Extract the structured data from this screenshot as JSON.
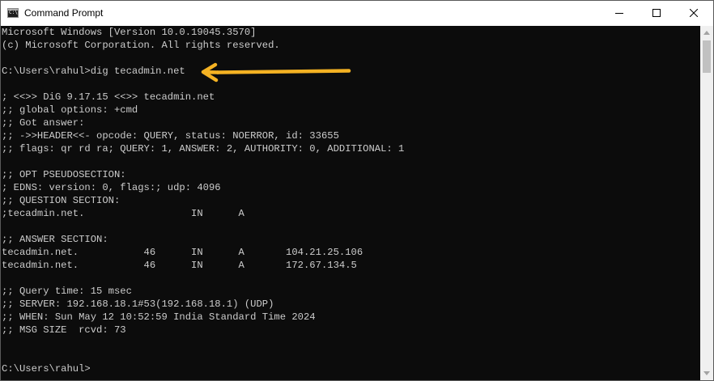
{
  "window": {
    "title": "Command Prompt",
    "app_icon_text": "C:\\"
  },
  "colors": {
    "console_background": "#0c0c0c",
    "console_text": "#cccccc",
    "annotation_arrow": "#f4b223"
  },
  "icons": {
    "app": "command-prompt-icon",
    "minimize": "minimize-icon",
    "maximize": "maximize-icon",
    "close": "close-icon",
    "annotation": "arrow-left-icon"
  },
  "console": {
    "lines": [
      "Microsoft Windows [Version 10.0.19045.3570]",
      "(c) Microsoft Corporation. All rights reserved.",
      "",
      "C:\\Users\\rahul>dig tecadmin.net",
      "",
      "; <<>> DiG 9.17.15 <<>> tecadmin.net",
      ";; global options: +cmd",
      ";; Got answer:",
      ";; ->>HEADER<<- opcode: QUERY, status: NOERROR, id: 33655",
      ";; flags: qr rd ra; QUERY: 1, ANSWER: 2, AUTHORITY: 0, ADDITIONAL: 1",
      "",
      ";; OPT PSEUDOSECTION:",
      "; EDNS: version: 0, flags:; udp: 4096",
      ";; QUESTION SECTION:",
      ";tecadmin.net.                  IN      A",
      "",
      ";; ANSWER SECTION:",
      "tecadmin.net.           46      IN      A       104.21.25.106",
      "tecadmin.net.           46      IN      A       172.67.134.5",
      "",
      ";; Query time: 15 msec",
      ";; SERVER: 192.168.18.1#53(192.168.18.1) (UDP)",
      ";; WHEN: Sun May 12 10:52:59 India Standard Time 2024",
      ";; MSG SIZE  rcvd: 73",
      "",
      "",
      "C:\\Users\\rahul>"
    ]
  }
}
